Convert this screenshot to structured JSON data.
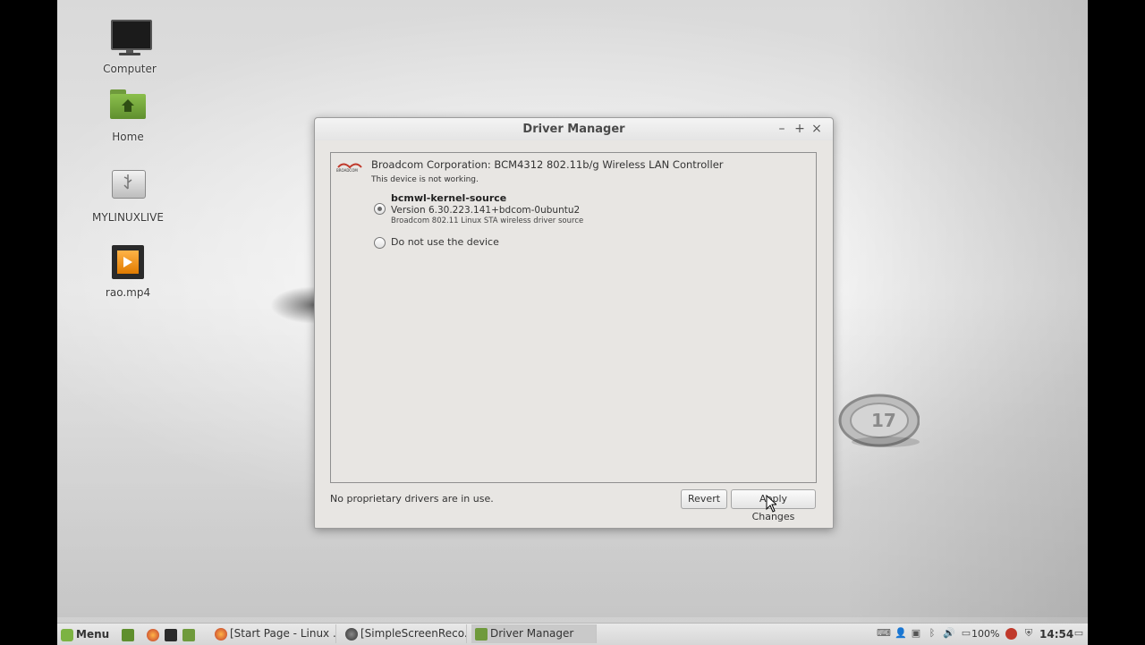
{
  "desktop": {
    "icons": [
      {
        "label": "Computer"
      },
      {
        "label": "Home"
      },
      {
        "label": "MYLINUXLIVE"
      },
      {
        "label": "rao.mp4"
      }
    ]
  },
  "window": {
    "title": "Driver Manager",
    "controls": {
      "minimize": "–",
      "maximize": "+",
      "close": "×"
    },
    "device": {
      "logo_text": "BROADCOM",
      "name": "Broadcom Corporation: BCM4312 802.11b/g Wireless LAN Controller",
      "status": "This device is not working."
    },
    "options": [
      {
        "name": "bcmwl-kernel-source",
        "version": "Version 6.30.223.141+bdcom-0ubuntu2",
        "description": "Broadcom 802.11 Linux STA wireless driver source",
        "selected": true
      },
      {
        "name": "Do not use the device",
        "selected": false
      }
    ],
    "status_text": "No proprietary drivers are in use.",
    "buttons": {
      "revert": "Revert",
      "apply": "Apply Changes"
    }
  },
  "taskbar": {
    "menu_label": "Menu",
    "tasks": [
      {
        "label": "[Start Page - Linux ..."
      },
      {
        "label": "[SimpleScreenReco..."
      },
      {
        "label": "Driver Manager",
        "active": true
      }
    ],
    "battery": "100%",
    "clock": "14:54"
  },
  "colors": {
    "mint_green": "#7cb342",
    "window_bg": "#e8e6e3"
  }
}
